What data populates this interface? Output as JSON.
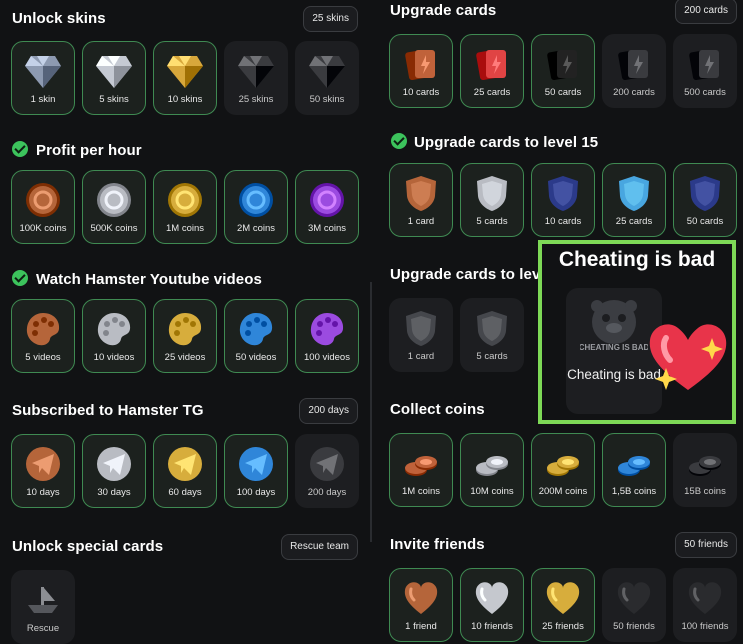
{
  "left": {
    "unlock_skins": {
      "title": "Unlock skins",
      "badge": "25 skins",
      "items": [
        {
          "label": "1 skin",
          "icon": "diamond-icon",
          "done": true,
          "color": "#8d9ab1"
        },
        {
          "label": "5 skins",
          "icon": "diamond-icon",
          "done": true,
          "color": "#c5cad3"
        },
        {
          "label": "10 skins",
          "icon": "diamond-icon",
          "done": true,
          "color": "#d7a73b"
        },
        {
          "label": "25 skins",
          "icon": "diamond-icon",
          "done": false,
          "color": "#3a3b3f"
        },
        {
          "label": "50 skins",
          "icon": "diamond-icon",
          "done": false,
          "color": "#3a3b3f"
        }
      ]
    },
    "profit_per_hour": {
      "title": "Profit per hour",
      "items": [
        {
          "label": "100K coins",
          "icon": "bronze-coin-icon",
          "done": true,
          "color": "#b5653a"
        },
        {
          "label": "500K coins",
          "icon": "silver-coin-icon",
          "done": true,
          "color": "#b9bcc3"
        },
        {
          "label": "1M coins",
          "icon": "gold-coin-icon",
          "done": true,
          "color": "#d7ad3c"
        },
        {
          "label": "2M coins",
          "icon": "blue-coin-icon",
          "done": true,
          "color": "#2f86d9"
        },
        {
          "label": "3M coins",
          "icon": "purple-coin-icon",
          "done": true,
          "color": "#9b4be0"
        }
      ]
    },
    "youtube_videos": {
      "title": "Watch Hamster Youtube videos",
      "items": [
        {
          "label": "5 videos",
          "icon": "palette-icon",
          "done": true,
          "color": "#b5653a"
        },
        {
          "label": "10 videos",
          "icon": "palette-icon",
          "done": true,
          "color": "#b9bcc3"
        },
        {
          "label": "25 videos",
          "icon": "palette-icon",
          "done": true,
          "color": "#d7ad3c"
        },
        {
          "label": "50 videos",
          "icon": "palette-icon",
          "done": true,
          "color": "#2f86d9"
        },
        {
          "label": "100 videos",
          "icon": "palette-icon",
          "done": true,
          "color": "#9b4be0"
        }
      ]
    },
    "hamster_tg": {
      "title": "Subscribed to Hamster TG",
      "badge": "200 days",
      "items": [
        {
          "label": "10 days",
          "icon": "telegram-plane-icon",
          "done": true,
          "color": "#b5653a"
        },
        {
          "label": "30 days",
          "icon": "telegram-plane-icon",
          "done": true,
          "color": "#b9bcc3"
        },
        {
          "label": "60 days",
          "icon": "telegram-plane-icon",
          "done": true,
          "color": "#d7ad3c"
        },
        {
          "label": "100 days",
          "icon": "telegram-plane-icon",
          "done": true,
          "color": "#2f86d9"
        },
        {
          "label": "200 days",
          "icon": "telegram-plane-icon",
          "done": false,
          "color": "#3a3b3f"
        }
      ]
    },
    "special_cards": {
      "title": "Unlock special cards",
      "badge": "Rescue team",
      "items": [
        {
          "label": "Rescue",
          "icon": "boat-icon",
          "done": false,
          "color": "#55575c"
        }
      ]
    }
  },
  "right": {
    "upgrade_cards": {
      "title": "Upgrade cards",
      "badge": "200 cards",
      "items": [
        {
          "label": "10 cards",
          "icon": "card-deck-icon",
          "done": true,
          "color": "#c0623a"
        },
        {
          "label": "25 cards",
          "icon": "card-deck-icon",
          "done": true,
          "color": "#e04444"
        },
        {
          "label": "50 cards",
          "icon": "card-deck-icon",
          "done": true,
          "color": "#222222"
        },
        {
          "label": "200 cards",
          "icon": "card-deck-icon",
          "done": false,
          "color": "#3a3b3f"
        },
        {
          "label": "500 cards",
          "icon": "card-deck-icon",
          "done": false,
          "color": "#3a3b3f"
        }
      ]
    },
    "level15": {
      "title": "Upgrade cards to level 15",
      "items": [
        {
          "label": "1 card",
          "icon": "shield-icon",
          "done": true,
          "color": "#b5653a"
        },
        {
          "label": "5 cards",
          "icon": "shield-icon",
          "done": true,
          "color": "#b9bcc3"
        },
        {
          "label": "10 cards",
          "icon": "shield-icon",
          "done": true,
          "color": "#2b3a8a"
        },
        {
          "label": "25 cards",
          "icon": "shield-icon",
          "done": true,
          "color": "#48a6e0"
        },
        {
          "label": "50 cards",
          "icon": "shield-icon",
          "done": true,
          "color": "#2b3a8a"
        }
      ]
    },
    "level_next": {
      "title": "Upgrade cards to level",
      "items": [
        {
          "label": "1 card",
          "icon": "shield-icon",
          "done": false,
          "color": "#45474c"
        },
        {
          "label": "5 cards",
          "icon": "shield-icon",
          "done": false,
          "color": "#45474c"
        }
      ]
    },
    "collect_coins": {
      "title": "Collect coins",
      "items": [
        {
          "label": "1M coins",
          "icon": "coin-stack-icon",
          "done": true,
          "color": "#c0623a"
        },
        {
          "label": "10M coins",
          "icon": "coin-stack-icon",
          "done": true,
          "color": "#b9bcc3"
        },
        {
          "label": "200M coins",
          "icon": "coin-stack-icon",
          "done": true,
          "color": "#d7ad3c"
        },
        {
          "label": "1,5B coins",
          "icon": "coin-stack-icon",
          "done": true,
          "color": "#2f86d9"
        },
        {
          "label": "15B coins",
          "icon": "coin-stack-icon",
          "done": false,
          "color": "#3a3b3f"
        }
      ]
    },
    "invite_friends": {
      "title": "Invite friends",
      "badge": "50 friends",
      "items": [
        {
          "label": "1 friend",
          "icon": "heart-icon",
          "done": true,
          "color": "#b5653a"
        },
        {
          "label": "10 friends",
          "icon": "heart-icon",
          "done": true,
          "color": "#c5c8ce"
        },
        {
          "label": "25 friends",
          "icon": "heart-icon",
          "done": true,
          "color": "#d7ad3c"
        },
        {
          "label": "50 friends",
          "icon": "heart-icon",
          "done": false,
          "color": "#2a2b2e"
        },
        {
          "label": "100 friends",
          "icon": "heart-icon",
          "done": false,
          "color": "#2a2b2e"
        }
      ]
    }
  },
  "overlay": {
    "title": "Cheating is bad",
    "card_label": "Cheating is bad",
    "image_text": "CHEATING IS BAD",
    "border_color": "#7ed957",
    "heart_color": "#e8344a"
  }
}
